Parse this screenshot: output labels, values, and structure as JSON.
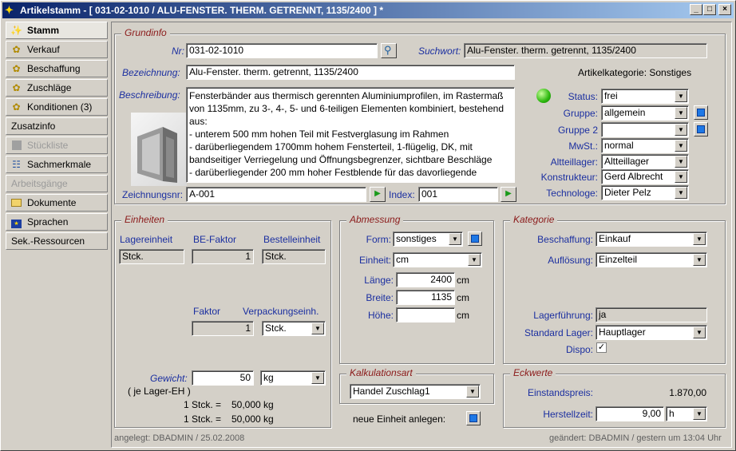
{
  "window": {
    "title": "Artikelstamm - [ 031-02-1010 / ALU-FENSTER. THERM. GETRENNT, 1135/2400 ] *",
    "min_label": "_",
    "max_label": "□",
    "close_label": "×"
  },
  "sidebar": {
    "items": [
      {
        "label": "Stamm",
        "icon": "wand-icon"
      },
      {
        "label": "Verkauf",
        "icon": "gear-icon"
      },
      {
        "label": "Beschaffung",
        "icon": "gear-icon"
      },
      {
        "label": "Zuschläge",
        "icon": "gear-icon"
      },
      {
        "label": "Konditionen (3)",
        "icon": "gear-icon"
      },
      {
        "label": "Zusatzinfo",
        "icon": ""
      },
      {
        "label": "Stückliste",
        "icon": "gray-box-icon"
      },
      {
        "label": "Sachmerkmale",
        "icon": "tree-icon"
      },
      {
        "label": "Arbeitsgänge",
        "icon": ""
      },
      {
        "label": "Dokumente",
        "icon": "folder-icon"
      },
      {
        "label": "Sprachen",
        "icon": "flag-icon"
      },
      {
        "label": "Sek.-Ressourcen",
        "icon": ""
      }
    ]
  },
  "grundinfo": {
    "legend": "Grundinfo",
    "nr_label": "Nr:",
    "nr_value": "031-02-1010",
    "suchwort_label": "Suchwort:",
    "suchwort_value": "Alu-Fenster. therm. getrennt, 1135/2400",
    "bezeichnung_label": "Bezeichnung:",
    "bezeichnung_value": "Alu-Fenster. therm. getrennt, 1135/2400",
    "artikelkategorie": "Artikelkategorie: Sonstiges",
    "beschreibung_label": "Beschreibung:",
    "beschreibung_value": "Fensterbänder aus thermisch gerennten Aluminiumprofilen, im Rastermaß von 1135mm, zu 3-, 4-, 5- und 6-teiligen Elementen kombiniert, bestehend aus:\n- unterem 500 mm hohen Teil mit Festverglasung im Rahmen\n- darüberliegendem 1700mm hohem Fensterteil, 1-flügelig, DK, mit bandseitiger Verriegelung und Öffnungsbegrenzer, sichtbare Beschläge\n- darüberliegender 200 mm hoher Festblende für das davorliegende",
    "zeichnungsnr_label": "Zeichnungsnr:",
    "zeichnungsnr_value": "A-001",
    "index_label": "Index:",
    "index_value": "001",
    "status_label": "Status:",
    "status_value": "frei",
    "gruppe_label": "Gruppe:",
    "gruppe_value": "allgemein",
    "gruppe2_label": "Gruppe 2",
    "gruppe2_value": "",
    "mwst_label": "MwSt.:",
    "mwst_value": "normal",
    "altteillager_label": "Altteillager:",
    "altteillager_value": "Altteillager",
    "konstrukteur_label": "Konstrukteur:",
    "konstrukteur_value": "Gerd Albrecht",
    "technologe_label": "Technologe:",
    "technologe_value": "Dieter Pelz"
  },
  "einheiten": {
    "legend": "Einheiten",
    "lagereinheit_label": "Lagereinheit",
    "lagereinheit_value": "Stck.",
    "befaktor_label": "BE-Faktor",
    "befaktor_value": "1",
    "bestelleinheit_label": "Bestelleinheit",
    "bestelleinheit_value": "Stck.",
    "faktor_label": "Faktor",
    "faktor_value": "1",
    "verpackung_label": "Verpackungseinh.",
    "verpackung_value": "Stck.",
    "gewicht_label": "Gewicht:",
    "gewicht_sub": "( je Lager-EH )",
    "gewicht_value": "50",
    "gewicht_unit": "kg",
    "line1_left": "1 Stck.  =",
    "line1_right": "50,000 kg",
    "line2_left": "1 Stck.  =",
    "line2_right": "50,000 kg"
  },
  "abmessung": {
    "legend": "Abmessung",
    "form_label": "Form:",
    "form_value": "sonstiges",
    "einheit_label": "Einheit:",
    "einheit_value": "cm",
    "laenge_label": "Länge:",
    "laenge_value": "2400",
    "breite_label": "Breite:",
    "breite_value": "1135",
    "hoehe_label": "Höhe:",
    "hoehe_value": "",
    "unit": "cm"
  },
  "kalkulation": {
    "legend": "Kalkulationsart",
    "value": "Handel Zuschlag1",
    "neue_einheit_label": "neue Einheit anlegen:"
  },
  "kategorie": {
    "legend": "Kategorie",
    "beschaffung_label": "Beschaffung:",
    "beschaffung_value": "Einkauf",
    "aufloesung_label": "Auflösung:",
    "aufloesung_value": "Einzelteil",
    "lagerfuehrung_label": "Lagerführung:",
    "lagerfuehrung_value": "ja",
    "standardlager_label": "Standard Lager:",
    "standardlager_value": "Hauptlager",
    "dispo_label": "Dispo:",
    "dispo_check": "✓"
  },
  "eckwerte": {
    "legend": "Eckwerte",
    "einstandspreis_label": "Einstandspreis:",
    "einstandspreis_value": "1.870,00",
    "herstellzeit_label": "Herstellzeit:",
    "herstellzeit_value": "9,00",
    "herstellzeit_unit": "h"
  },
  "footer": {
    "angelegt": "angelegt: DBADMIN / 25.02.2008",
    "geaendert": "geändert: DBADMIN / gestern um 13:04 Uhr"
  }
}
